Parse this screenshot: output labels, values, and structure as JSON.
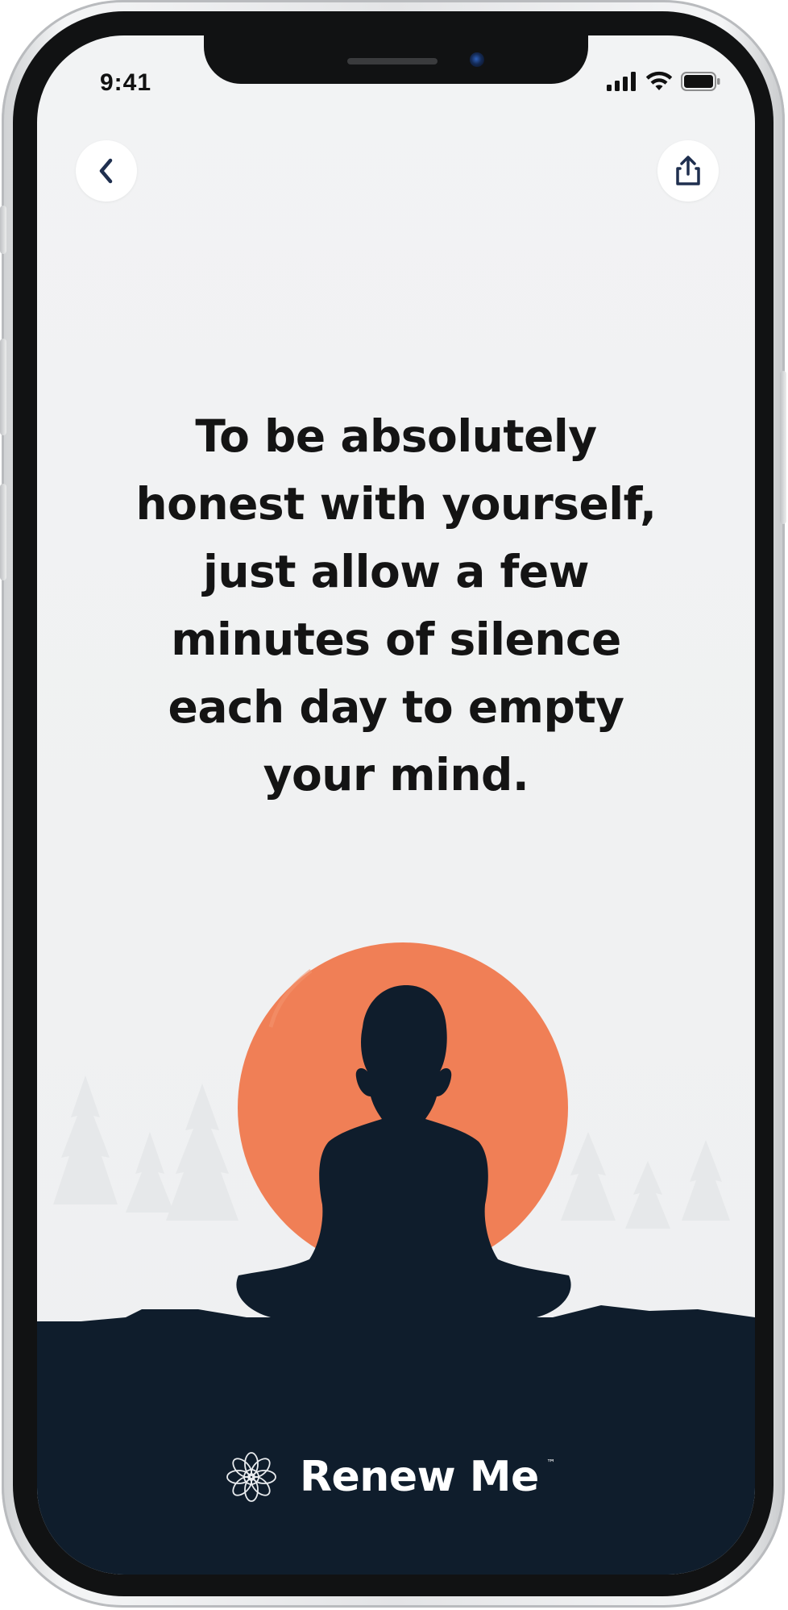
{
  "status_bar": {
    "time": "9:41",
    "signal_icon": "cellular-signal-icon",
    "wifi_icon": "wifi-icon",
    "battery_icon": "battery-icon"
  },
  "nav": {
    "back_icon": "chevron-left-icon",
    "share_icon": "share-icon"
  },
  "quote": {
    "lines": [
      "To be absolutely",
      "honest with yourself,",
      "just allow a few",
      "minutes of silence",
      "each day to empty",
      "your mind."
    ]
  },
  "illustration": {
    "sun_color": "#f07f56",
    "silhouette_color": "#0f1d2c",
    "tree_color": "#e6e8ea"
  },
  "brand": {
    "icon": "mandala-logo-icon",
    "name": "Renew Me",
    "trademark": "™"
  }
}
